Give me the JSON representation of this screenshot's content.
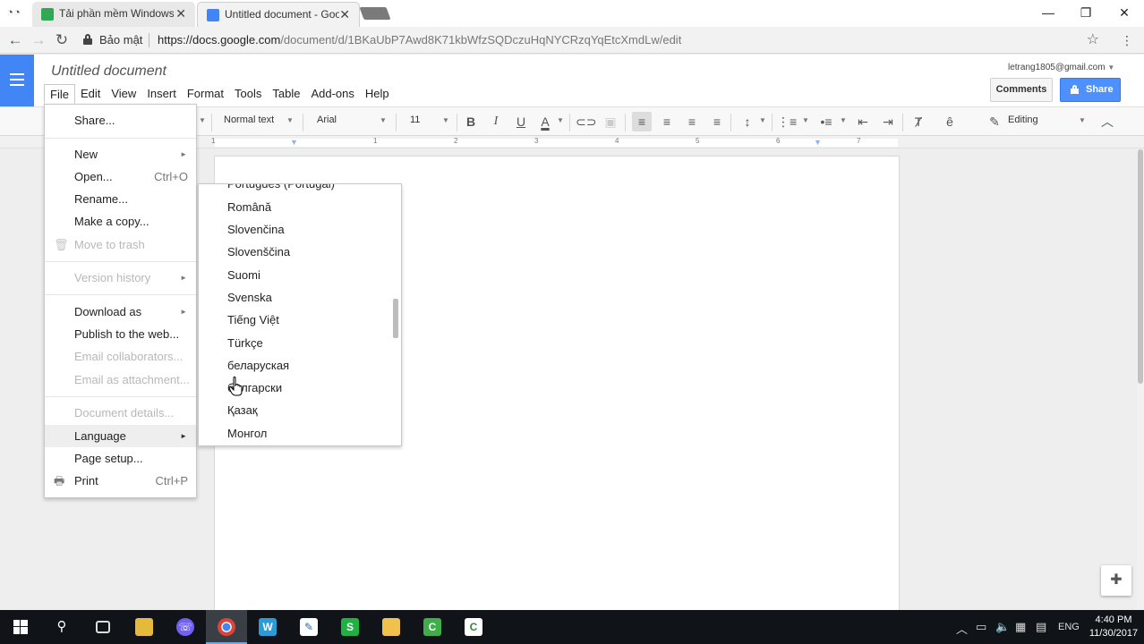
{
  "browser": {
    "tabs": [
      {
        "title": "Tải phần mềm Windows",
        "close": "✕"
      },
      {
        "title": "Untitled document - Goo",
        "close": "✕"
      }
    ],
    "window_controls": {
      "minimize": "—",
      "maximize": "❐",
      "close": "✕"
    },
    "address": {
      "secure_label": "Bảo mật",
      "url_host": "https://docs.google.com",
      "url_path": "/document/d/1BKaUbP7Awd8K71kbWfzSQDczuHqNYCRzqYqEtcXmdLw/edit"
    }
  },
  "docs": {
    "title": "Untitled document",
    "account": "letrang1805@gmail.com",
    "comments_label": "Comments",
    "share_label": "Share",
    "menubar": [
      "File",
      "Edit",
      "View",
      "Insert",
      "Format",
      "Tools",
      "Table",
      "Add-ons",
      "Help"
    ],
    "toolbar": {
      "style": "Normal text",
      "font": "Arial",
      "size": "11",
      "mode": "Editing",
      "ext_glyph": "ê"
    },
    "ruler_numbers": [
      "1",
      "1",
      "2",
      "3",
      "4",
      "5",
      "6",
      "7"
    ]
  },
  "file_menu": {
    "share": "Share...",
    "new": "New",
    "open": "Open...",
    "open_shortcut": "Ctrl+O",
    "rename": "Rename...",
    "make_copy": "Make a copy...",
    "move_to_trash": "Move to trash",
    "version_history": "Version history",
    "download_as": "Download as",
    "publish": "Publish to the web...",
    "email_collaborators": "Email collaborators...",
    "email_attachment": "Email as attachment...",
    "document_details": "Document details...",
    "language": "Language",
    "page_setup": "Page setup...",
    "print": "Print",
    "print_shortcut": "Ctrl+P"
  },
  "language_menu": {
    "items": [
      "Português (Portugal)",
      "Română",
      "Slovenčina",
      "Slovenščina",
      "Suomi",
      "Svenska",
      "Tiếng Việt",
      "Türkçe",
      "беларуская",
      "български",
      "Қазақ",
      "Монгол"
    ]
  },
  "taskbar": {
    "language": "ENG",
    "time": "4:40 PM",
    "date": "11/30/2017"
  }
}
